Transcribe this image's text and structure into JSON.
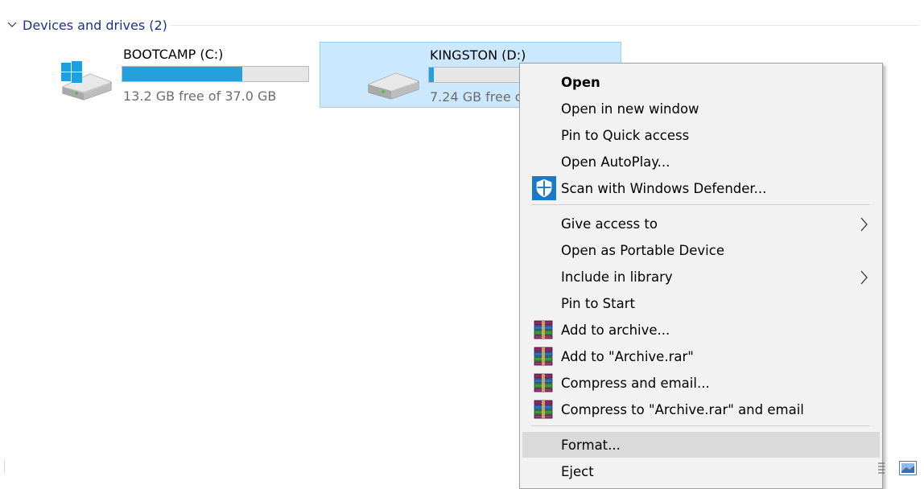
{
  "group": {
    "title": "Devices and drives (2)"
  },
  "drives": [
    {
      "name": "BOOTCAMP (C:)",
      "free_text": "13.2 GB free of 37.0 GB",
      "used_fraction": 0.643,
      "icon": "windows-drive-icon"
    },
    {
      "name": "KINGSTON (D:)",
      "free_text": "7.24 GB free o",
      "used_fraction": 0.05,
      "icon": "drive-icon",
      "selected": true
    }
  ],
  "menu": {
    "open": "Open",
    "open_new_window": "Open in new window",
    "pin_quick": "Pin to Quick access",
    "open_autoplay": "Open AutoPlay...",
    "scan_defender": "Scan with Windows Defender...",
    "give_access": "Give access to",
    "open_portable": "Open as Portable Device",
    "include_library": "Include in library",
    "pin_start": "Pin to Start",
    "add_archive": "Add to archive...",
    "add_archive_rar": "Add to \"Archive.rar\"",
    "compress_email": "Compress and email...",
    "compress_rar_email": "Compress to \"Archive.rar\" and email",
    "format": "Format...",
    "eject": "Eject"
  },
  "colors": {
    "selection_bg": "#cce8ff",
    "bar_fill": "#26a0da",
    "header_text": "#1e3287",
    "menu_bg": "#f2f2f2",
    "menu_hover": "#dadada"
  }
}
